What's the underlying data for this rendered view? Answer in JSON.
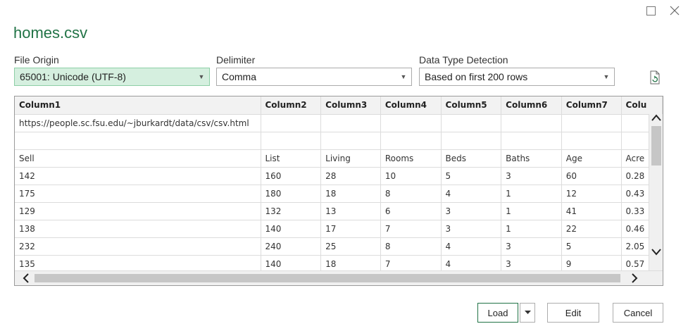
{
  "window": {
    "title": "homes.csv"
  },
  "options": {
    "file_origin_label": "File Origin",
    "file_origin_value": "65001: Unicode (UTF-8)",
    "delimiter_label": "Delimiter",
    "delimiter_value": "Comma",
    "detection_label": "Data Type Detection",
    "detection_value": "Based on first 200 rows"
  },
  "table": {
    "headers": [
      "Column1",
      "Column2",
      "Column3",
      "Column4",
      "Column5",
      "Column6",
      "Column7",
      "Colu"
    ],
    "rows": [
      [
        "https://people.sc.fsu.edu/~jburkardt/data/csv/csv.html",
        "",
        "",
        "",
        "",
        "",
        "",
        ""
      ],
      [
        "",
        "",
        "",
        "",
        "",
        "",
        "",
        ""
      ],
      [
        "Sell",
        "List",
        "Living",
        "Rooms",
        "Beds",
        "Baths",
        "Age",
        "Acre"
      ],
      [
        "142",
        "160",
        "28",
        "10",
        "5",
        "3",
        "60",
        "0.28"
      ],
      [
        "175",
        "180",
        "18",
        "8",
        "4",
        "1",
        "12",
        "0.43"
      ],
      [
        "129",
        "132",
        "13",
        "6",
        "3",
        "1",
        "41",
        "0.33"
      ],
      [
        "138",
        "140",
        "17",
        "7",
        "3",
        "1",
        "22",
        "0.46"
      ],
      [
        "232",
        "240",
        "25",
        "8",
        "4",
        "3",
        "5",
        "2.05"
      ],
      [
        "135",
        "140",
        "18",
        "7",
        "4",
        "3",
        "9",
        "0.57"
      ]
    ]
  },
  "buttons": {
    "load": "Load",
    "edit": "Edit",
    "cancel": "Cancel"
  },
  "colors": {
    "accent": "#217346",
    "selected_dropdown": "#d5efdf"
  }
}
